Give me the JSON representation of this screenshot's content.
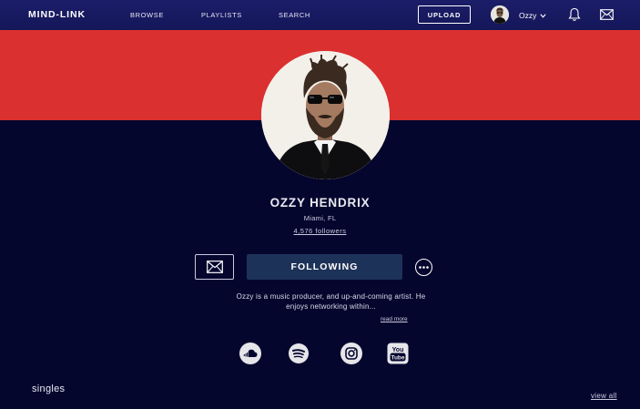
{
  "nav": {
    "logo": "MIND-LINK",
    "links": [
      "BROWSE",
      "PLAYLISTS",
      "SEARCH"
    ],
    "upload_label": "UPLOAD",
    "user_name": "Ozzy"
  },
  "profile": {
    "name": "OZZY HENDRIX",
    "location": "Miami, FL",
    "followers": "4,576 followers",
    "following_label": "FOLLOWING",
    "bio": "Ozzy is a music producer, and up-and-coming artist. He enjoys networking within...",
    "read_more": "read more",
    "social_icons": [
      "soundcloud-icon",
      "spotify-icon",
      "instagram-icon",
      "youtube-icon"
    ]
  },
  "singles": {
    "heading": "singles",
    "view_all": "view all"
  },
  "colors": {
    "nav_bg": "#1b1d68",
    "banner": "#db3030",
    "page_bg": "#05062e",
    "following_btn": "#1d3258"
  }
}
